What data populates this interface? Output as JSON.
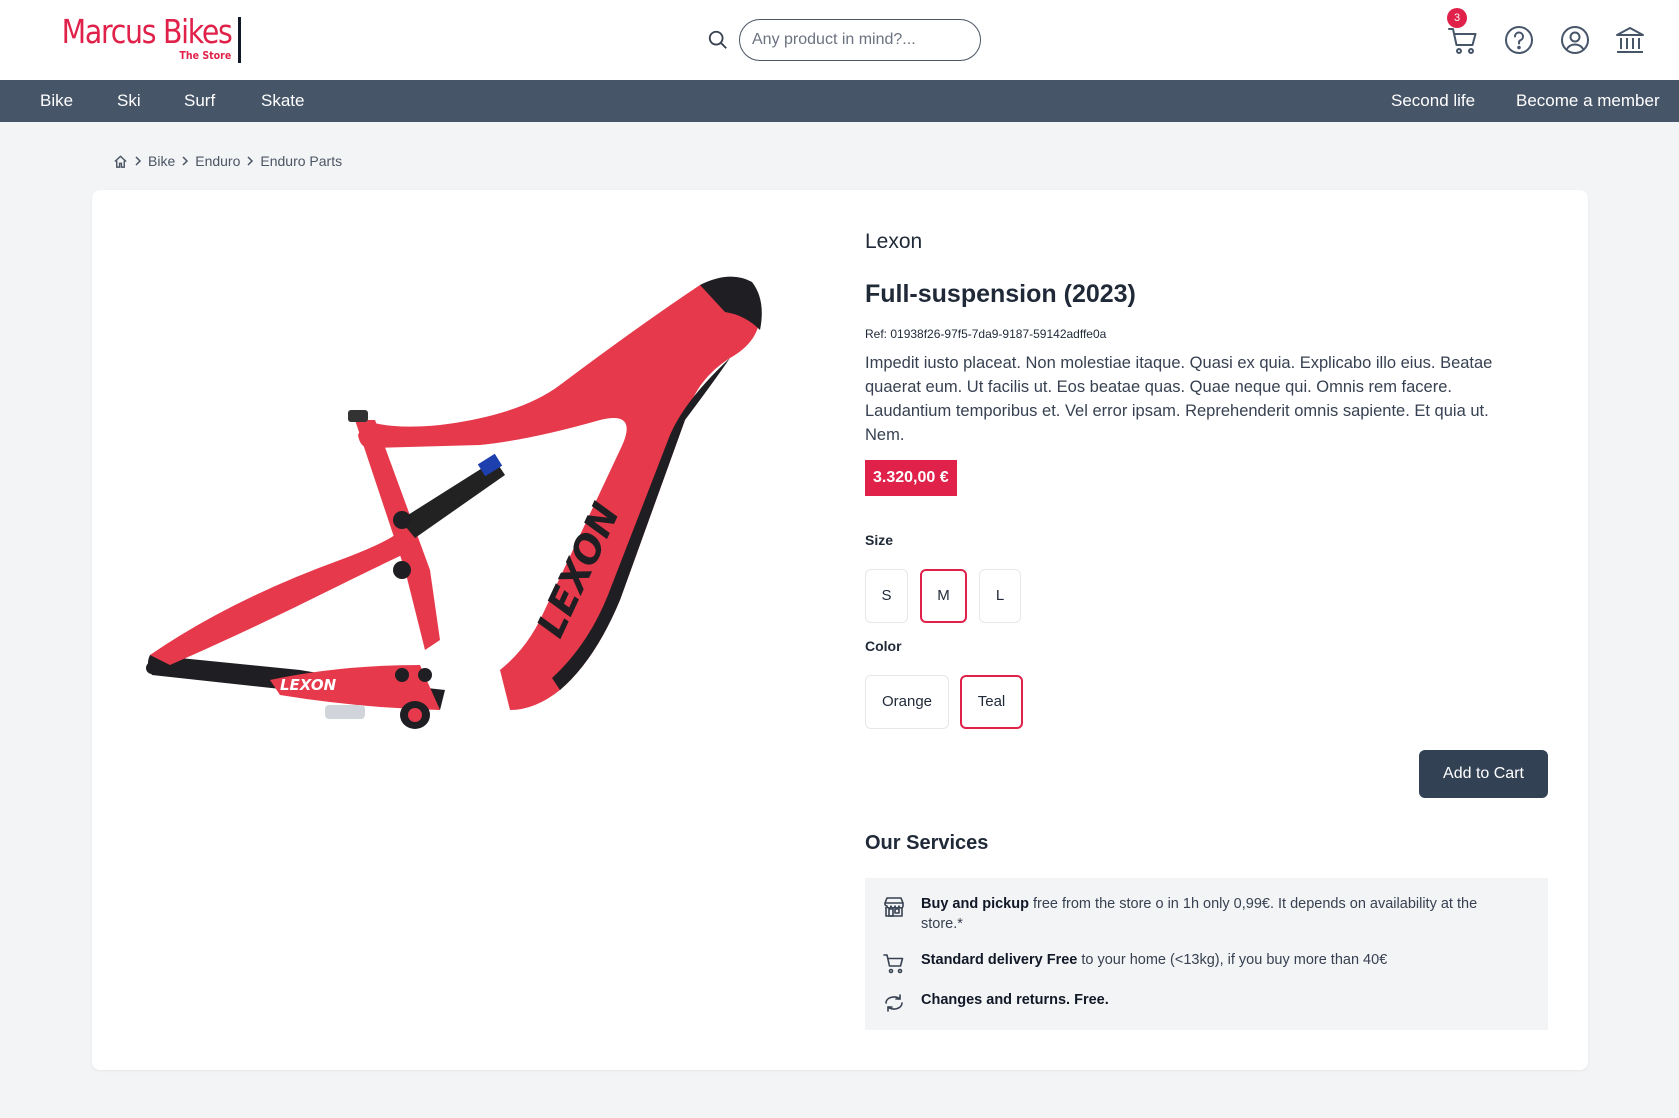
{
  "logo": {
    "main": "Marcus Bikes",
    "sub": "The Store"
  },
  "search": {
    "placeholder": "Any product in mind?..."
  },
  "header": {
    "cart_count": "3"
  },
  "nav": {
    "left": [
      "Bike",
      "Ski",
      "Surf",
      "Skate"
    ],
    "right": [
      "Second life",
      "Become a member"
    ]
  },
  "breadcrumb": [
    "Bike",
    "Enduro",
    "Enduro Parts"
  ],
  "product": {
    "brand": "Lexon",
    "title": "Full-suspension (2023)",
    "ref": "Ref: 01938f26-97f5-7da9-9187-59142adffe0a",
    "description": "Impedit iusto placeat. Non molestiae itaque. Quasi ex quia. Explicabo illo eius. Beatae quaerat eum. Ut facilis ut. Eos beatae quas. Quae neque qui. Omnis rem facere. Laudantium temporibus et. Vel error ipsam. Reprehenderit omnis sapiente. Et quia ut. Nem.",
    "price": "3.320,00 €",
    "frame_text": "LEXON",
    "frame_color": "#e6394b"
  },
  "options": {
    "size_label": "Size",
    "sizes": [
      "S",
      "M",
      "L"
    ],
    "selected_size": "M",
    "color_label": "Color",
    "colors": [
      "Orange",
      "Teal"
    ],
    "selected_color": "Teal"
  },
  "add_to_cart": "Add to Cart",
  "services": {
    "title": "Our Services",
    "items": [
      {
        "bold": "Buy and pickup",
        "text": " free from the store o in 1h only 0,99€. It depends on availability at the store.*",
        "icon": "store-icon"
      },
      {
        "bold": "Standard delivery Free",
        "text": " to your home (<13kg), if you buy more than 40€",
        "icon": "cart-icon"
      },
      {
        "bold": "Changes and returns. Free.",
        "text": "",
        "icon": "refresh-icon"
      }
    ]
  },
  "colors": {
    "accent": "#e0224a",
    "nav_bg": "#475569",
    "button_bg": "#334155"
  }
}
